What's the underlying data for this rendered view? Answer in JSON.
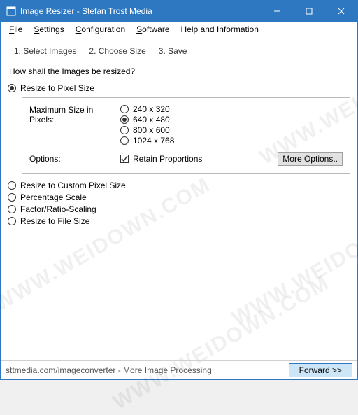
{
  "window": {
    "title": "Image Resizer - Stefan Trost Media"
  },
  "menu": {
    "file": "File",
    "settings": "Settings",
    "configuration": "Configuration",
    "software": "Software",
    "help": "Help and Information"
  },
  "tabs": {
    "t1": "1. Select Images",
    "t2": "2. Choose Size",
    "t3": "3. Save"
  },
  "prompt": "How shall the Images be resized?",
  "modes": {
    "pixel": "Resize to Pixel Size",
    "custom": "Resize to Custom Pixel Size",
    "percent": "Percentage Scale",
    "factor": "Factor/Ratio-Scaling",
    "filesize": "Resize to File Size"
  },
  "panel": {
    "maxsize_label": "Maximum Size in Pixels:",
    "size1": "240 x 320",
    "size2": "640 x 480",
    "size3": "800 x 600",
    "size4": "1024 x 768",
    "options_label": "Options:",
    "retain": "Retain Proportions",
    "more": "More Options.."
  },
  "status": {
    "text": "sttmedia.com/imageconverter - More Image Processing",
    "forward": "Forward >>"
  },
  "watermark": "WWW.WEIDOWN.COM"
}
